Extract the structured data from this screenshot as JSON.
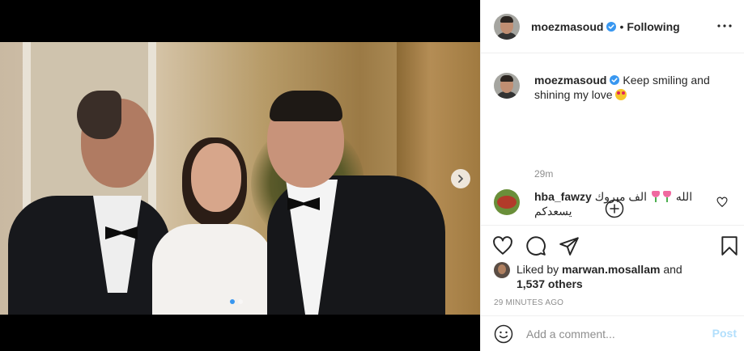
{
  "post": {
    "author": "moezmasoud",
    "follow_separator": "•",
    "follow_label": "Following",
    "caption_text": "Keep smiling and shining my love",
    "caption_emoji": "star-struck-emoji",
    "caption_time": "29m",
    "carousel": {
      "slide_count": 2,
      "active_slide": 1
    }
  },
  "comments": [
    {
      "user": "hba_fawzy",
      "text_part1": "الف مبروك",
      "text_part2": "الله",
      "text_part3": "يسعدكم",
      "emoji": "tulip-emoji"
    }
  ],
  "likes": {
    "prefix": "Liked by",
    "user": "marwan.mosallam",
    "conjunction": "and",
    "count_text": "1,537 others"
  },
  "timestamp": "29 MINUTES AGO",
  "composer": {
    "placeholder": "Add a comment...",
    "post_label": "Post"
  },
  "colors": {
    "verified": "#3897f0",
    "post_disabled": "#b2dffc",
    "muted": "#8e8e8e"
  }
}
